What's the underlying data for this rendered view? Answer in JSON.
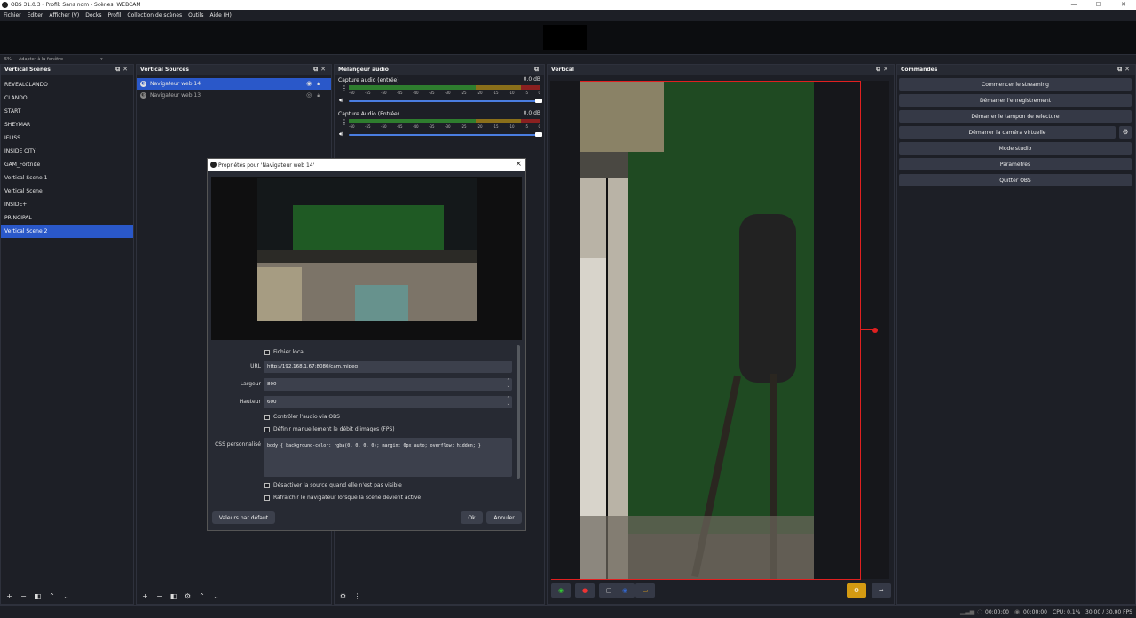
{
  "window": {
    "title": "OBS 31.0.3 - Profil: Sans nom - Scènes: WEBCAM",
    "min": "—",
    "max": "☐",
    "close": "✕"
  },
  "menu": [
    "Fichier",
    "Editer",
    "Afficher (V)",
    "Docks",
    "Profil",
    "Collection de scènes",
    "Outils",
    "Aide (H)"
  ],
  "zoom": {
    "percent": "5%",
    "mode": "Adapter à la fenêtre"
  },
  "scenes": {
    "title": "Vertical Scènes",
    "items": [
      "REVEALCLANDO",
      "CLANDO",
      "START",
      "SHEYMAR",
      "IFLISS",
      "INSIDE CITY",
      "GAM_Fortnite",
      "Vertical Scene 1",
      "Vertical Scene",
      "INSIDE+",
      "PRINCIPAL",
      "Vertical Scene 2"
    ],
    "selected_index": 11
  },
  "sources": {
    "title": "Vertical Sources",
    "items": [
      "Navigateur web 14",
      "Navigateur web 13"
    ]
  },
  "mixer": {
    "title": "Mélangeur audio",
    "channels": [
      {
        "name": "Capture audio (entrée)",
        "db": "0.0 dB"
      },
      {
        "name": "Capture Audio (Entrée)",
        "db": "0.0 dB"
      }
    ],
    "scale": [
      "-60",
      "-55",
      "-50",
      "-45",
      "-40",
      "-35",
      "-30",
      "-25",
      "-20",
      "-15",
      "-10",
      "-5",
      "0"
    ]
  },
  "preview": {
    "title": "Vertical"
  },
  "commands": {
    "title": "Commandes",
    "buttons": [
      "Commencer le streaming",
      "Démarrer l'enregistrement",
      "Démarrer le tampon de relecture",
      "Démarrer la caméra virtuelle",
      "Mode studio",
      "Paramètres",
      "Quitter OBS"
    ]
  },
  "dialog": {
    "title": "Propriétés pour 'Navigateur web 14'",
    "local_file": "Fichier local",
    "url_label": "URL",
    "url_value": "http://192.168.1.67:8080/cam.mjpeg",
    "width_label": "Largeur",
    "width_value": "800",
    "height_label": "Hauteur",
    "height_value": "600",
    "audio_control": "Contrôler l'audio via OBS",
    "manual_fps": "Définir manuellement le débit d'images (FPS)",
    "css_label": "CSS personnalisé",
    "css_value": "body { background-color: rgba(0, 0, 0, 0); margin: 0px auto; overflow: hidden; }",
    "disable_hidden": "Désactiver la source quand elle n'est pas visible",
    "refresh_active": "Rafraîchir le navigateur lorsque la scène devient active",
    "defaults_btn": "Valeurs par défaut",
    "ok_btn": "Ok",
    "cancel_btn": "Annuler"
  },
  "status": {
    "rec_time": "00:00:00",
    "stream_time": "00:00:00",
    "cpu": "CPU: 0.1%",
    "fps": "30.00 / 30.00 FPS"
  }
}
